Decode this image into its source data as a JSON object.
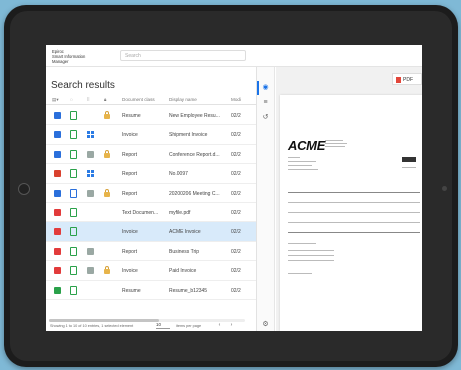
{
  "app": {
    "title_lines": [
      "Epiroc",
      "Smart Information",
      "Manager"
    ]
  },
  "search": {
    "placeholder": "Search"
  },
  "results": {
    "title": "Search results",
    "columns": {
      "document_class": "Document class",
      "display_name": "Display name",
      "modified": "Modi"
    },
    "rows": [
      {
        "doc_class": "Resume",
        "display_name": "New Employee Resu...",
        "modified": "02/2",
        "app_color": "#2a6fdb",
        "doc_color": "#2aa14a",
        "mid": "none",
        "locked": true,
        "selected": false
      },
      {
        "doc_class": "Invoice",
        "display_name": "Shipment Invoice",
        "modified": "02/2",
        "app_color": "#2a6fdb",
        "doc_color": "#2aa14a",
        "mid": "grid",
        "locked": false,
        "selected": false
      },
      {
        "doc_class": "Report",
        "display_name": "Conference Report.d...",
        "modified": "02/2",
        "app_color": "#2a6fdb",
        "doc_color": "#2aa14a",
        "mid": "image",
        "locked": true,
        "selected": false
      },
      {
        "doc_class": "Report",
        "display_name": "No.0097",
        "modified": "02/2",
        "app_color": "#d9412e",
        "doc_color": "#2aa14a",
        "mid": "grid",
        "locked": false,
        "selected": false
      },
      {
        "doc_class": "Report",
        "display_name": "20200206 Meeting C...",
        "modified": "02/2",
        "app_color": "#2a6fdb",
        "doc_color": "#2a6fdb",
        "mid": "image",
        "locked": true,
        "selected": false
      },
      {
        "doc_class": "Text Documen...",
        "display_name": "myfile.pdf",
        "modified": "02/2",
        "app_color": "#e23b3b",
        "doc_color": "#2aa14a",
        "mid": "none",
        "locked": false,
        "selected": false
      },
      {
        "doc_class": "Invoice",
        "display_name": "ACME Invoice",
        "modified": "02/2",
        "app_color": "#e23b3b",
        "doc_color": "#2aa14a",
        "mid": "none",
        "locked": false,
        "selected": true
      },
      {
        "doc_class": "Report",
        "display_name": "Business Trip",
        "modified": "02/2",
        "app_color": "#e23b3b",
        "doc_color": "#2aa14a",
        "mid": "image",
        "locked": false,
        "selected": false
      },
      {
        "doc_class": "Invoice",
        "display_name": "Paid Invoice",
        "modified": "02/2",
        "app_color": "#e23b3b",
        "doc_color": "#2aa14a",
        "mid": "image",
        "locked": true,
        "selected": false
      },
      {
        "doc_class": "Resume",
        "display_name": "Resume_b12345",
        "modified": "02/2",
        "app_color": "#2aa14a",
        "doc_color": "#2aa14a",
        "mid": "none",
        "locked": false,
        "selected": false
      }
    ]
  },
  "footer": {
    "status": "Showing 1 to 10 of 10 entries, 1 selected element",
    "page_size": "10",
    "items_per_page": "items per page"
  },
  "preview": {
    "pdf_label": "PDF",
    "company": "ACME"
  },
  "colors": {
    "accent": "#1a73e8",
    "selected_row": "#d8eafa",
    "lock": "#e7b44a"
  }
}
